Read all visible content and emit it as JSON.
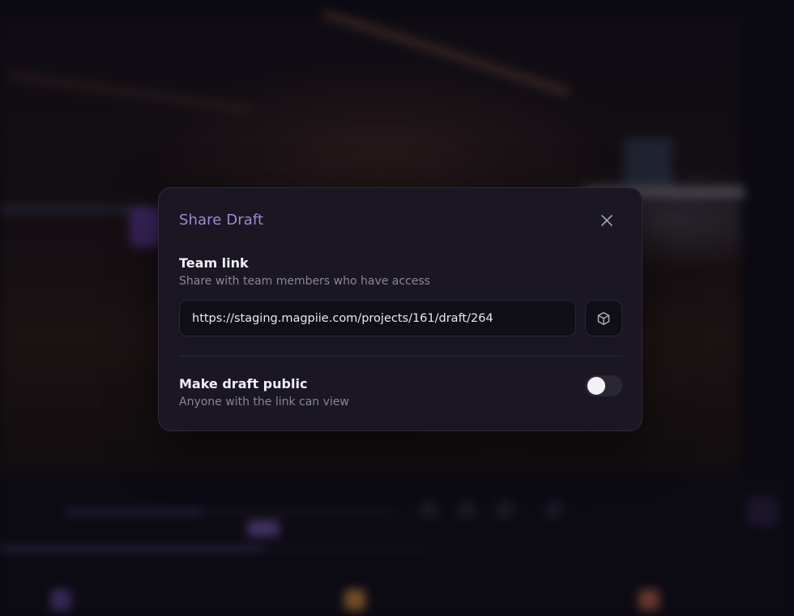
{
  "dialog": {
    "title": "Share Draft",
    "close_icon": "close-icon"
  },
  "team_link": {
    "heading": "Team link",
    "description": "Share with team members who have access",
    "url": "https://staging.magpiie.com/projects/161/draft/264",
    "copy_icon": "cube-icon"
  },
  "public": {
    "heading": "Make draft public",
    "description": "Anyone with the link can view",
    "enabled": false
  },
  "colors": {
    "accent": "#9b8ad1",
    "modal_bg": "#1a1723",
    "input_bg": "#100e16"
  }
}
